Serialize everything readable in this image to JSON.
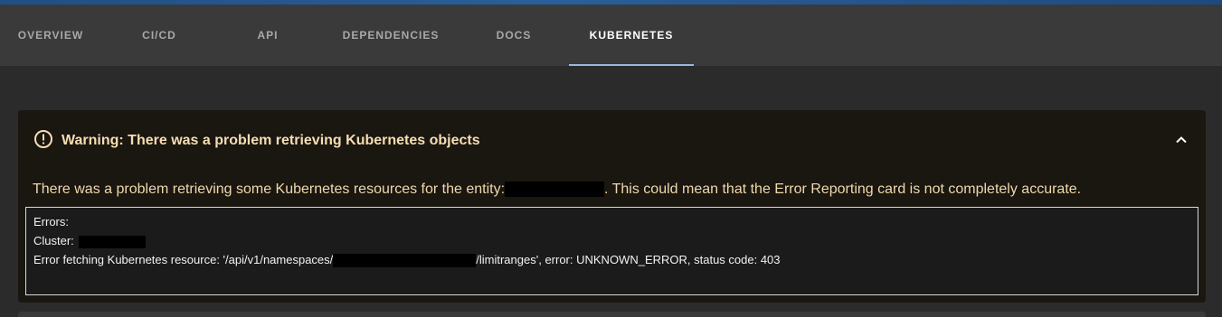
{
  "tabs": [
    {
      "label": "OVERVIEW",
      "active": false
    },
    {
      "label": "CI/CD",
      "active": false
    },
    {
      "label": "API",
      "active": false
    },
    {
      "label": "DEPENDENCIES",
      "active": false
    },
    {
      "label": "DOCS",
      "active": false
    },
    {
      "label": "KUBERNETES",
      "active": true
    }
  ],
  "alert": {
    "icon": "warning-circle-icon",
    "title": "Warning: There was a problem retrieving Kubernetes objects",
    "message_prefix": "There was a problem retrieving some Kubernetes resources for the entity:",
    "message_suffix": ". This could mean that the Error Reporting card is not completely accurate.",
    "errors_heading": "Errors:",
    "cluster_label": "Cluster:",
    "error_prefix": "Error fetching Kubernetes resource: '/api/v1/namespaces/",
    "error_suffix": "/limitranges', error: UNKNOWN_ERROR, status code: 403",
    "collapse_icon": "chevron-up-icon"
  },
  "colors": {
    "accent": "#9bb6e3",
    "warning_text": "#f5deb3",
    "alert_bg": "#1a1610"
  }
}
